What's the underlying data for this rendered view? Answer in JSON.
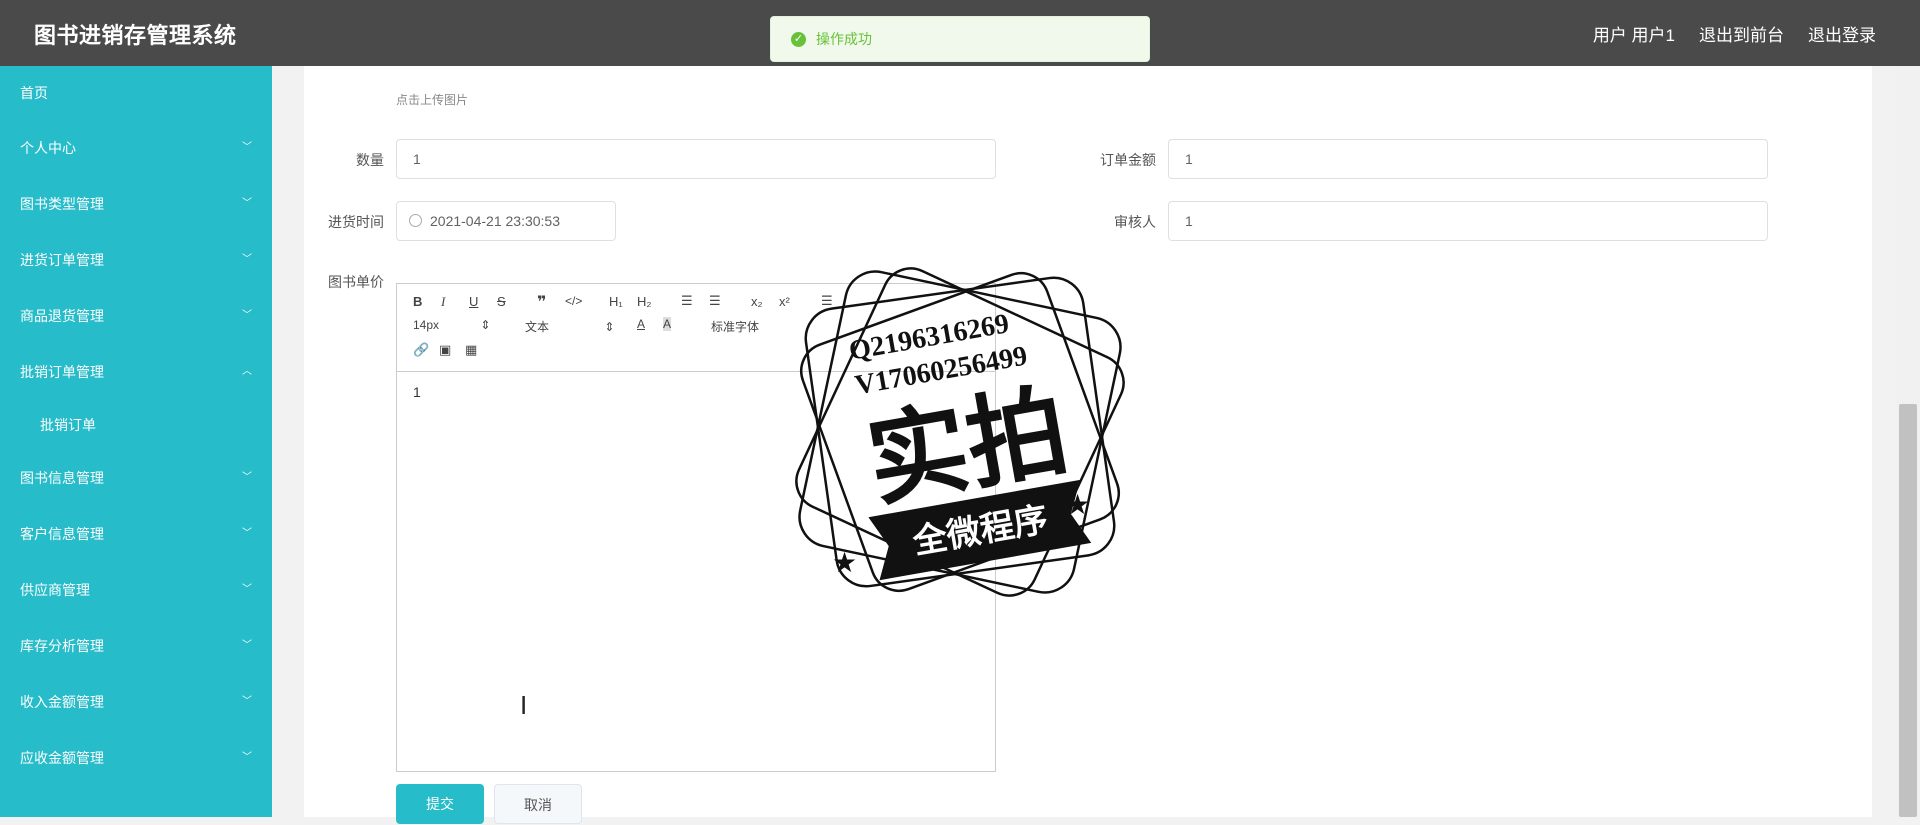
{
  "header": {
    "title": "图书进销存管理系统",
    "user": "用户 用户1",
    "to_front": "退出到前台",
    "logout": "退出登录"
  },
  "toast": {
    "message": "操作成功"
  },
  "sidebar": {
    "items": [
      {
        "label": "首页"
      },
      {
        "label": "个人中心"
      },
      {
        "label": "图书类型管理"
      },
      {
        "label": "进货订单管理"
      },
      {
        "label": "商品退货管理"
      },
      {
        "label": "批销订单管理"
      },
      {
        "label": "批销订单"
      },
      {
        "label": "图书信息管理"
      },
      {
        "label": "客户信息管理"
      },
      {
        "label": "供应商管理"
      },
      {
        "label": "库存分析管理"
      },
      {
        "label": "收入金额管理"
      },
      {
        "label": "应收金额管理"
      }
    ]
  },
  "form": {
    "upload_tip": "点击上传图片",
    "quantity_label": "数量",
    "quantity_value": "1",
    "amount_label": "订单金额",
    "amount_value": "1",
    "time_label": "进货时间",
    "time_value": "2021-04-21 23:30:53",
    "reviewer_label": "审核人",
    "reviewer_value": "1",
    "price_label": "图书单价",
    "editor_content": "1",
    "submit_label": "提交",
    "cancel_label": "取消"
  },
  "editor_toolbar": {
    "font_size": "14px",
    "paragraph": "文本",
    "font_family": "标准字体"
  },
  "watermark": {
    "line1": "Q2196316269",
    "line2": "V17060256499",
    "main": "实拍",
    "banner": "全微程序"
  }
}
